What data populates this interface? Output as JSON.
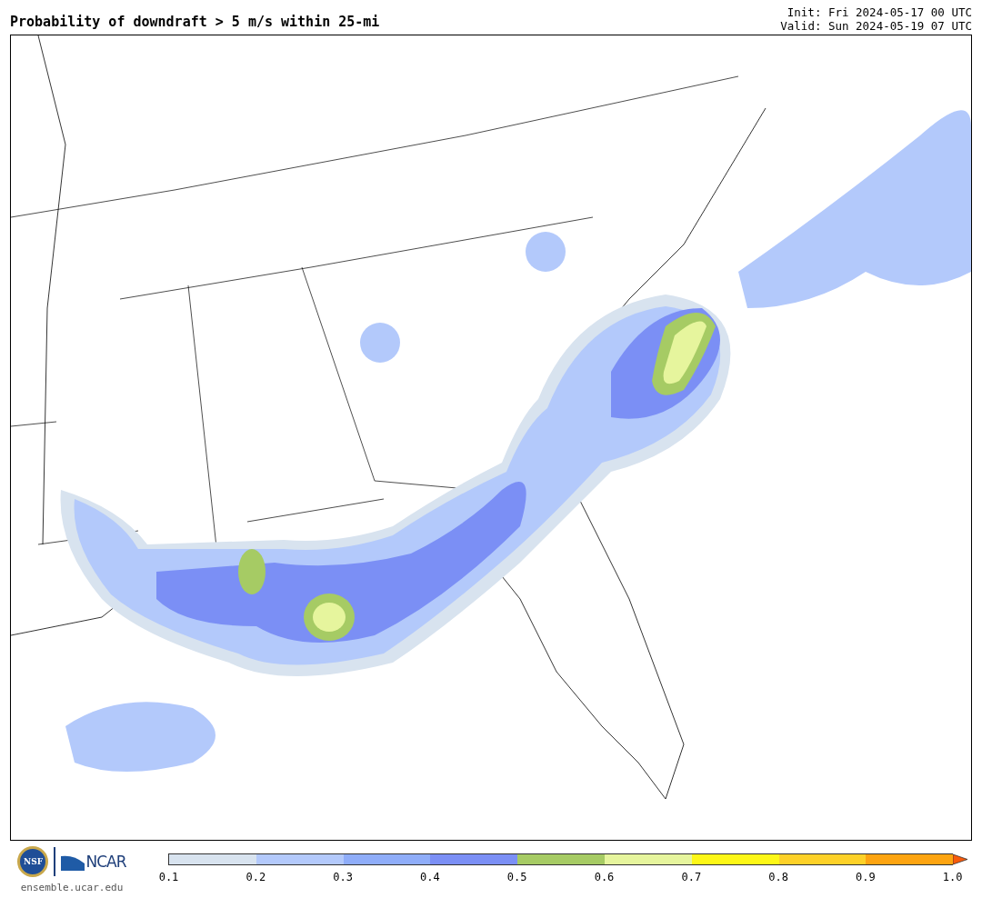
{
  "title": "Probability of downdraft > 5 m/s within 25-mi",
  "run_info": [
    "Init: Fri 2024-05-17 00 UTC",
    "Valid: Sun 2024-05-19 07 UTC"
  ],
  "logo": {
    "seal_text": "NSF",
    "name": "NCAR",
    "url": "ensemble.ucar.edu"
  },
  "colorbar": {
    "segments": [
      {
        "color": "#d8e3ef"
      },
      {
        "color": "#b3c9fb"
      },
      {
        "color": "#8fadf9"
      },
      {
        "color": "#7b8ff5"
      },
      {
        "color": "#a6cb64"
      },
      {
        "color": "#e6f59d"
      },
      {
        "color": "#fdf717"
      },
      {
        "color": "#fdd128"
      },
      {
        "color": "#fda411"
      },
      {
        "color": "#f75b0c",
        "kind": "arrow"
      }
    ],
    "ticks": [
      "0.1",
      "0.2",
      "0.3",
      "0.4",
      "0.5",
      "0.6",
      "0.7",
      "0.8",
      "0.9",
      "1.0"
    ]
  }
}
